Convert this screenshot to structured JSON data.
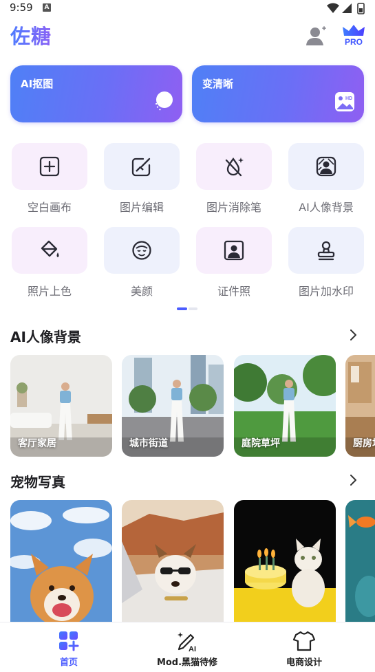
{
  "status_bar": {
    "time": "9:59",
    "notif_badge": "A"
  },
  "header": {
    "app_title": "佐糖",
    "pro_label": "PRO"
  },
  "hero_cards": [
    {
      "label": "AI抠图",
      "icon": "cutout-icon"
    },
    {
      "label": "变清晰",
      "icon": "hd-image-icon"
    }
  ],
  "tools": [
    {
      "label": "空白画布",
      "icon": "plus-square-icon"
    },
    {
      "label": "图片编辑",
      "icon": "edit-image-icon"
    },
    {
      "label": "图片消除笔",
      "icon": "eraser-drop-icon"
    },
    {
      "label": "AI人像背景",
      "icon": "portrait-bg-icon"
    },
    {
      "label": "照片上色",
      "icon": "paint-bucket-icon"
    },
    {
      "label": "美颜",
      "icon": "face-icon"
    },
    {
      "label": "证件照",
      "icon": "id-photo-icon"
    },
    {
      "label": "图片加水印",
      "icon": "stamp-icon"
    }
  ],
  "sections": {
    "portrait_bg": {
      "title": "AI人像背景",
      "cards": [
        "客厅家居",
        "城市街道",
        "庭院草坪",
        "厨房场"
      ]
    },
    "pet_photo": {
      "title": "宠物写真"
    }
  },
  "bottom_nav": [
    {
      "label": "首页",
      "active": true,
      "icon": "home-grid-icon"
    },
    {
      "label": "Mod.黑猫待修",
      "active": false,
      "icon": "ai-pen-icon"
    },
    {
      "label": "电商设计",
      "active": false,
      "icon": "tshirt-icon"
    }
  ],
  "colors": {
    "accent": "#4b5cff",
    "hero_start": "#4f80f6",
    "hero_end": "#8f5ff2"
  }
}
